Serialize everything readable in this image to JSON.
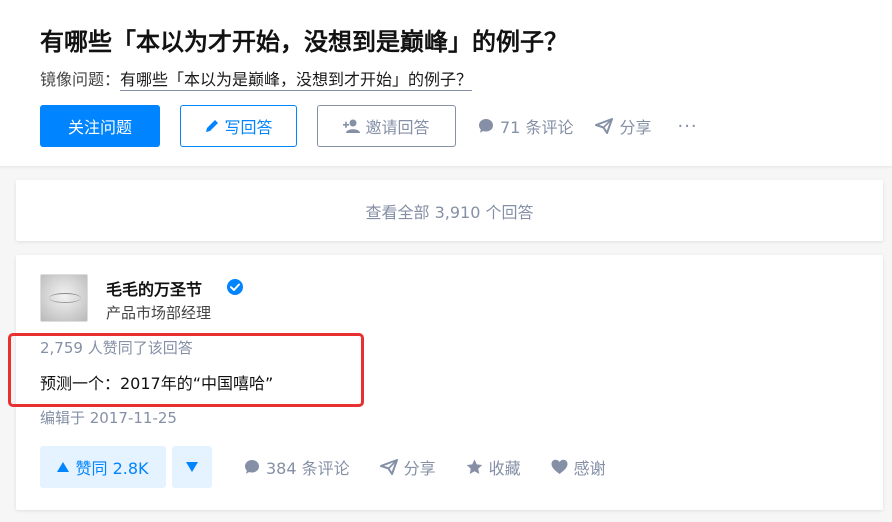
{
  "question": {
    "title": "有哪些「本以为才开始，没想到是巅峰」的例子？",
    "mirror_prefix": "镜像问题：",
    "mirror_link": "有哪些「本以为是巅峰，没想到才开始」的例子？"
  },
  "actions": {
    "follow_label": "关注问题",
    "write_label": "写回答",
    "invite_label": "邀请回答",
    "comments_label": "71 条评论",
    "share_label": "分享",
    "more_label": "···"
  },
  "view_all_label": "查看全部 3,910 个回答",
  "answer": {
    "author_name": "毛毛的万圣节",
    "author_headline": "产品市场部经理",
    "votes_text": "2,759 人赞同了该回答",
    "content": "预测一个：2017年的“中国嘻哈”",
    "edited_text": "编辑于 2017-11-25",
    "upvote_label": "赞同 2.8K",
    "comments_label": "384 条评论",
    "share_label": "分享",
    "collect_label": "收藏",
    "thanks_label": "感谢"
  },
  "colors": {
    "brand_blue": "#0084ff",
    "meta_gray": "#8590a6",
    "highlight_red": "#e8312f",
    "upvote_bg": "#e5f2ff"
  }
}
